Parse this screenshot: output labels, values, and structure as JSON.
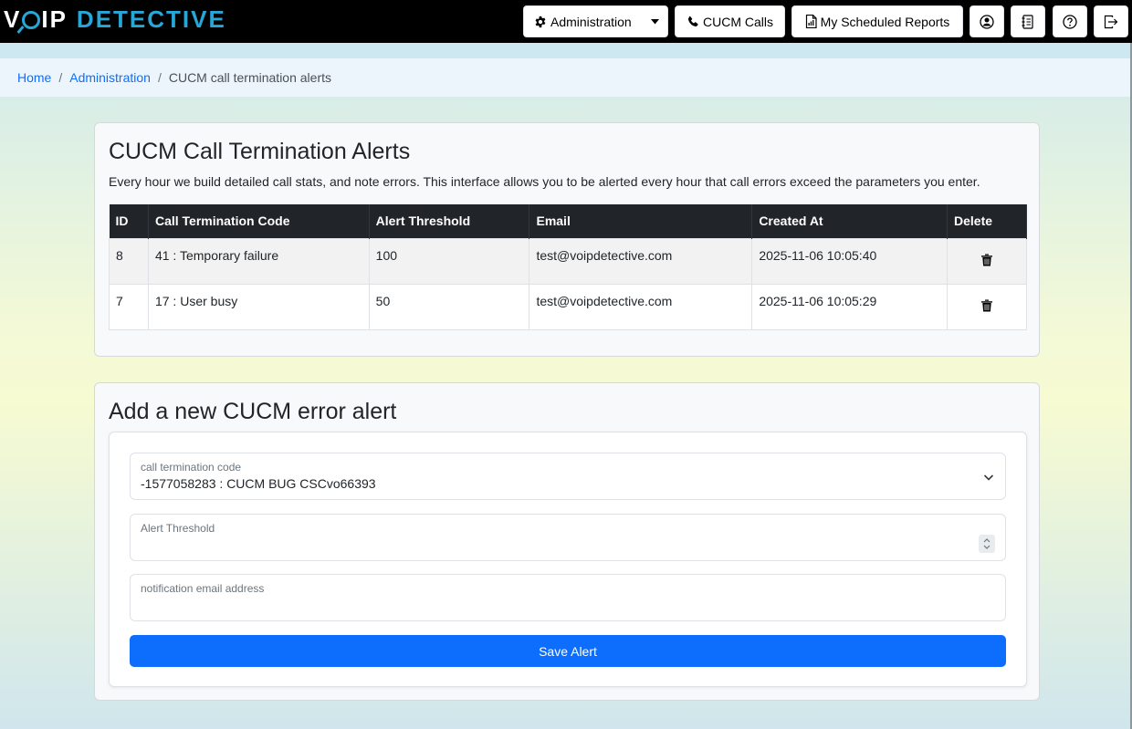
{
  "brand": {
    "voip_prefix": "V",
    "voip_suffix": "IP",
    "detective": "DETECTIVE"
  },
  "navbar": {
    "administration_label": "Administration",
    "cucm_calls_label": "CUCM Calls",
    "scheduled_reports_label": "My Scheduled Reports",
    "icons": [
      "gear-icon",
      "chevron-down-icon",
      "phone-icon",
      "report-icon",
      "user-circle-icon",
      "notebook-icon",
      "help-icon",
      "logout-icon"
    ]
  },
  "breadcrumb": {
    "home": "Home",
    "administration": "Administration",
    "current": "CUCM call termination alerts",
    "separator": "/"
  },
  "alerts_card": {
    "title": "CUCM Call Termination Alerts",
    "description": "Every hour we build detailed call stats, and note errors. This interface allows you to be alerted every hour that call errors exceed the parameters you enter.",
    "columns": [
      "ID",
      "Call Termination Code",
      "Alert Threshold",
      "Email",
      "Created At",
      "Delete"
    ],
    "rows": [
      {
        "id": "8",
        "code": "41 : Temporary failure",
        "threshold": "100",
        "email": "test@voipdetective.com",
        "created_at": "2025-11-06 10:05:40"
      },
      {
        "id": "7",
        "code": "17 : User busy",
        "threshold": "50",
        "email": "test@voipdetective.com",
        "created_at": "2025-11-06 10:05:29"
      }
    ]
  },
  "form_card": {
    "title": "Add a new CUCM error alert",
    "code_label": "call termination code",
    "code_value": "-1577058283 : CUCM BUG CSCvo66393",
    "threshold_label": "Alert Threshold",
    "threshold_value": "",
    "email_label": "notification email address",
    "email_value": "",
    "save_label": "Save Alert"
  },
  "colors": {
    "primary": "#0d6efd",
    "navbar": "#000000",
    "brand_accent": "#27a7d8",
    "table_header": "#212529"
  }
}
